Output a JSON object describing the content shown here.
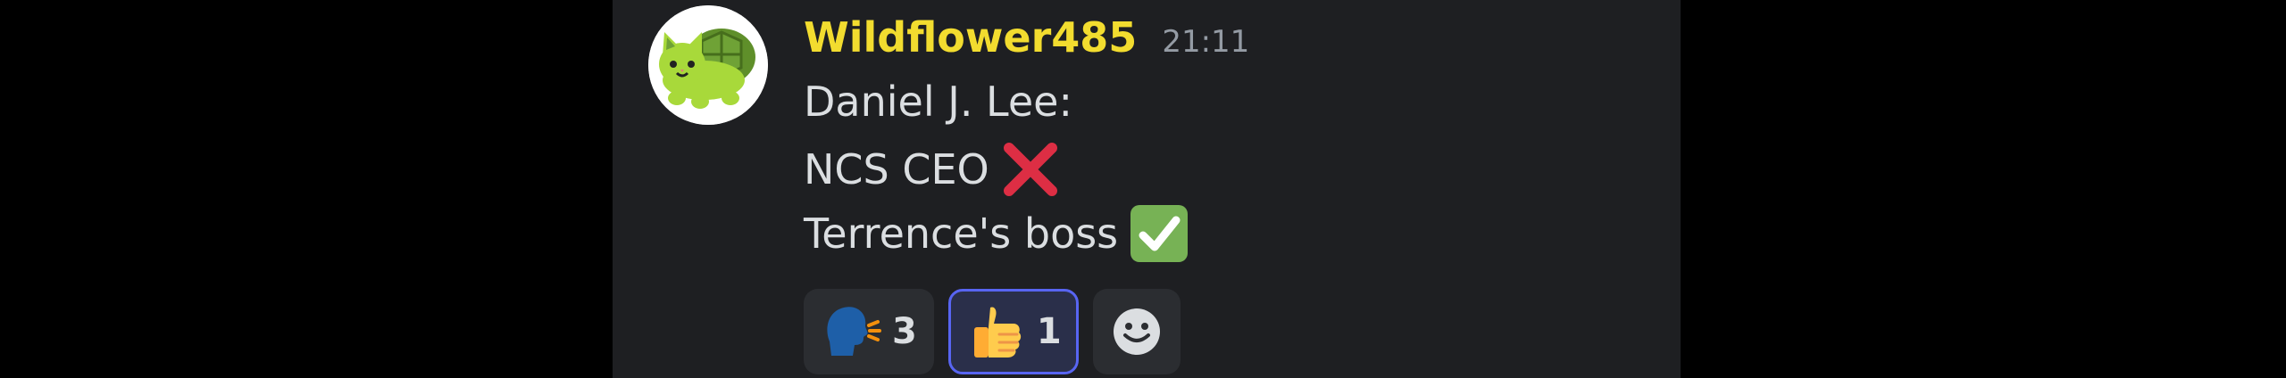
{
  "message": {
    "username": "Wildflower485",
    "timestamp": "21:11",
    "lines": [
      {
        "text": "Daniel J. Lee:",
        "emoji": null
      },
      {
        "text": "NCS CEO",
        "emoji": "red-cross-mark"
      },
      {
        "text": "Terrence's boss",
        "emoji": "green-check-mark"
      }
    ]
  },
  "reactions": [
    {
      "emoji": "speaking-head",
      "count": "3",
      "active": false
    },
    {
      "emoji": "thumbs-up",
      "count": "1",
      "active": true
    }
  ],
  "add_reaction": {
    "icon": "smiley-add-reaction-icon"
  },
  "colors": {
    "username": "#f2dc2f",
    "text": "#dbdee1",
    "timestamp": "#949ba4",
    "panel": "#1e1f22",
    "reaction_bg": "#2b2d31",
    "reaction_active_border": "#5865f2"
  }
}
